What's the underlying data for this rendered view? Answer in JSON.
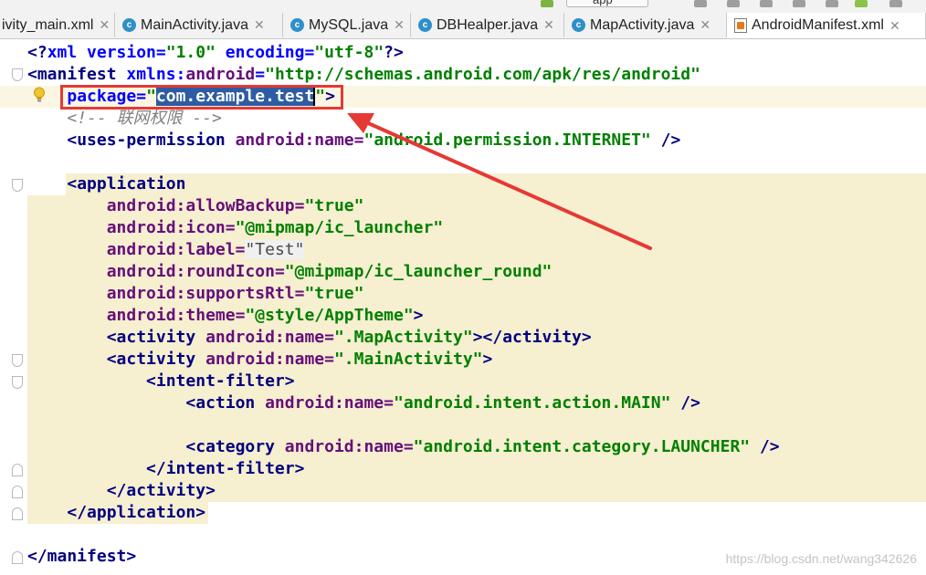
{
  "tabs": [
    {
      "label": "ivity_main.xml",
      "icon": "xml-file-icon",
      "active": false
    },
    {
      "label": "MainActivity.java",
      "icon": "java-class-icon",
      "active": false
    },
    {
      "label": "MySQL.java",
      "icon": "java-class-icon",
      "active": false
    },
    {
      "label": "DBHealper.java",
      "icon": "java-class-icon",
      "active": false
    },
    {
      "label": "MapActivity.java",
      "icon": "java-class-icon",
      "active": false
    },
    {
      "label": "AndroidManifest.xml",
      "icon": "manifest-file-icon",
      "active": true
    }
  ],
  "run_config": "app",
  "code": {
    "l1": {
      "a": "<?",
      "b": "xml version=",
      "c": "\"1.0\"",
      "d": " encoding=",
      "e": "\"utf-8\"",
      "f": "?>"
    },
    "l2": {
      "a": "<manifest ",
      "b": "xmlns:",
      "c": "android",
      "d": "=",
      "e": "\"http://schemas.android.com/apk/res/android\""
    },
    "l3": {
      "indent": "    ",
      "a": "package=",
      "b": "\"",
      "c": "com.example.test",
      "d": "\"",
      "e": ">"
    },
    "l4": {
      "indent": "    ",
      "a": "<!-- 联网权限 -->"
    },
    "l5": {
      "indent": "    ",
      "a": "<uses-permission ",
      "b": "android:",
      "c": "name=",
      "d": "\"android.permission.INTERNET\"",
      "e": " />"
    },
    "l7": {
      "indent": "    ",
      "a": "<application"
    },
    "l8": {
      "indent": "        ",
      "a": "android:",
      "b": "allowBackup=",
      "c": "\"true\""
    },
    "l9": {
      "indent": "        ",
      "a": "android:",
      "b": "icon=",
      "c": "\"@mipmap/ic_launcher\""
    },
    "l10": {
      "indent": "        ",
      "a": "android:",
      "b": "label=",
      "c": "\"Test\""
    },
    "l11": {
      "indent": "        ",
      "a": "android:",
      "b": "roundIcon=",
      "c": "\"@mipmap/ic_launcher_round\""
    },
    "l12": {
      "indent": "        ",
      "a": "android:",
      "b": "supportsRtl=",
      "c": "\"true\""
    },
    "l13": {
      "indent": "        ",
      "a": "android:",
      "b": "theme=",
      "c": "\"@style/AppTheme\"",
      "d": ">"
    },
    "l14": {
      "indent": "        ",
      "a": "<activity ",
      "b": "android:",
      "c": "name=",
      "d": "\".MapActivity\"",
      "e": "></activity>"
    },
    "l15": {
      "indent": "        ",
      "a": "<activity ",
      "b": "android:",
      "c": "name=",
      "d": "\".MainActivity\"",
      "e": ">"
    },
    "l16": {
      "indent": "            ",
      "a": "<intent-filter>"
    },
    "l17": {
      "indent": "                ",
      "a": "<action ",
      "b": "android:",
      "c": "name=",
      "d": "\"android.intent.action.MAIN\"",
      "e": " />"
    },
    "l19": {
      "indent": "                ",
      "a": "<category ",
      "b": "android:",
      "c": "name=",
      "d": "\"android.intent.category.LAUNCHER\"",
      "e": " />"
    },
    "l20": {
      "indent": "            ",
      "a": "</intent-filter>"
    },
    "l21": {
      "indent": "        ",
      "a": "</activity>"
    },
    "l22": {
      "indent": "    ",
      "a": "</application>"
    },
    "l24": {
      "a": "</manifest>"
    }
  },
  "annotation": {
    "color": "#e53935"
  },
  "watermark": "https://blog.csdn.net/wang342626",
  "colors": {
    "selection": "#2d5ca3",
    "highlight": "#f6efd0",
    "tag": "#000080",
    "attr": "#660e7a",
    "value": "#008000"
  }
}
